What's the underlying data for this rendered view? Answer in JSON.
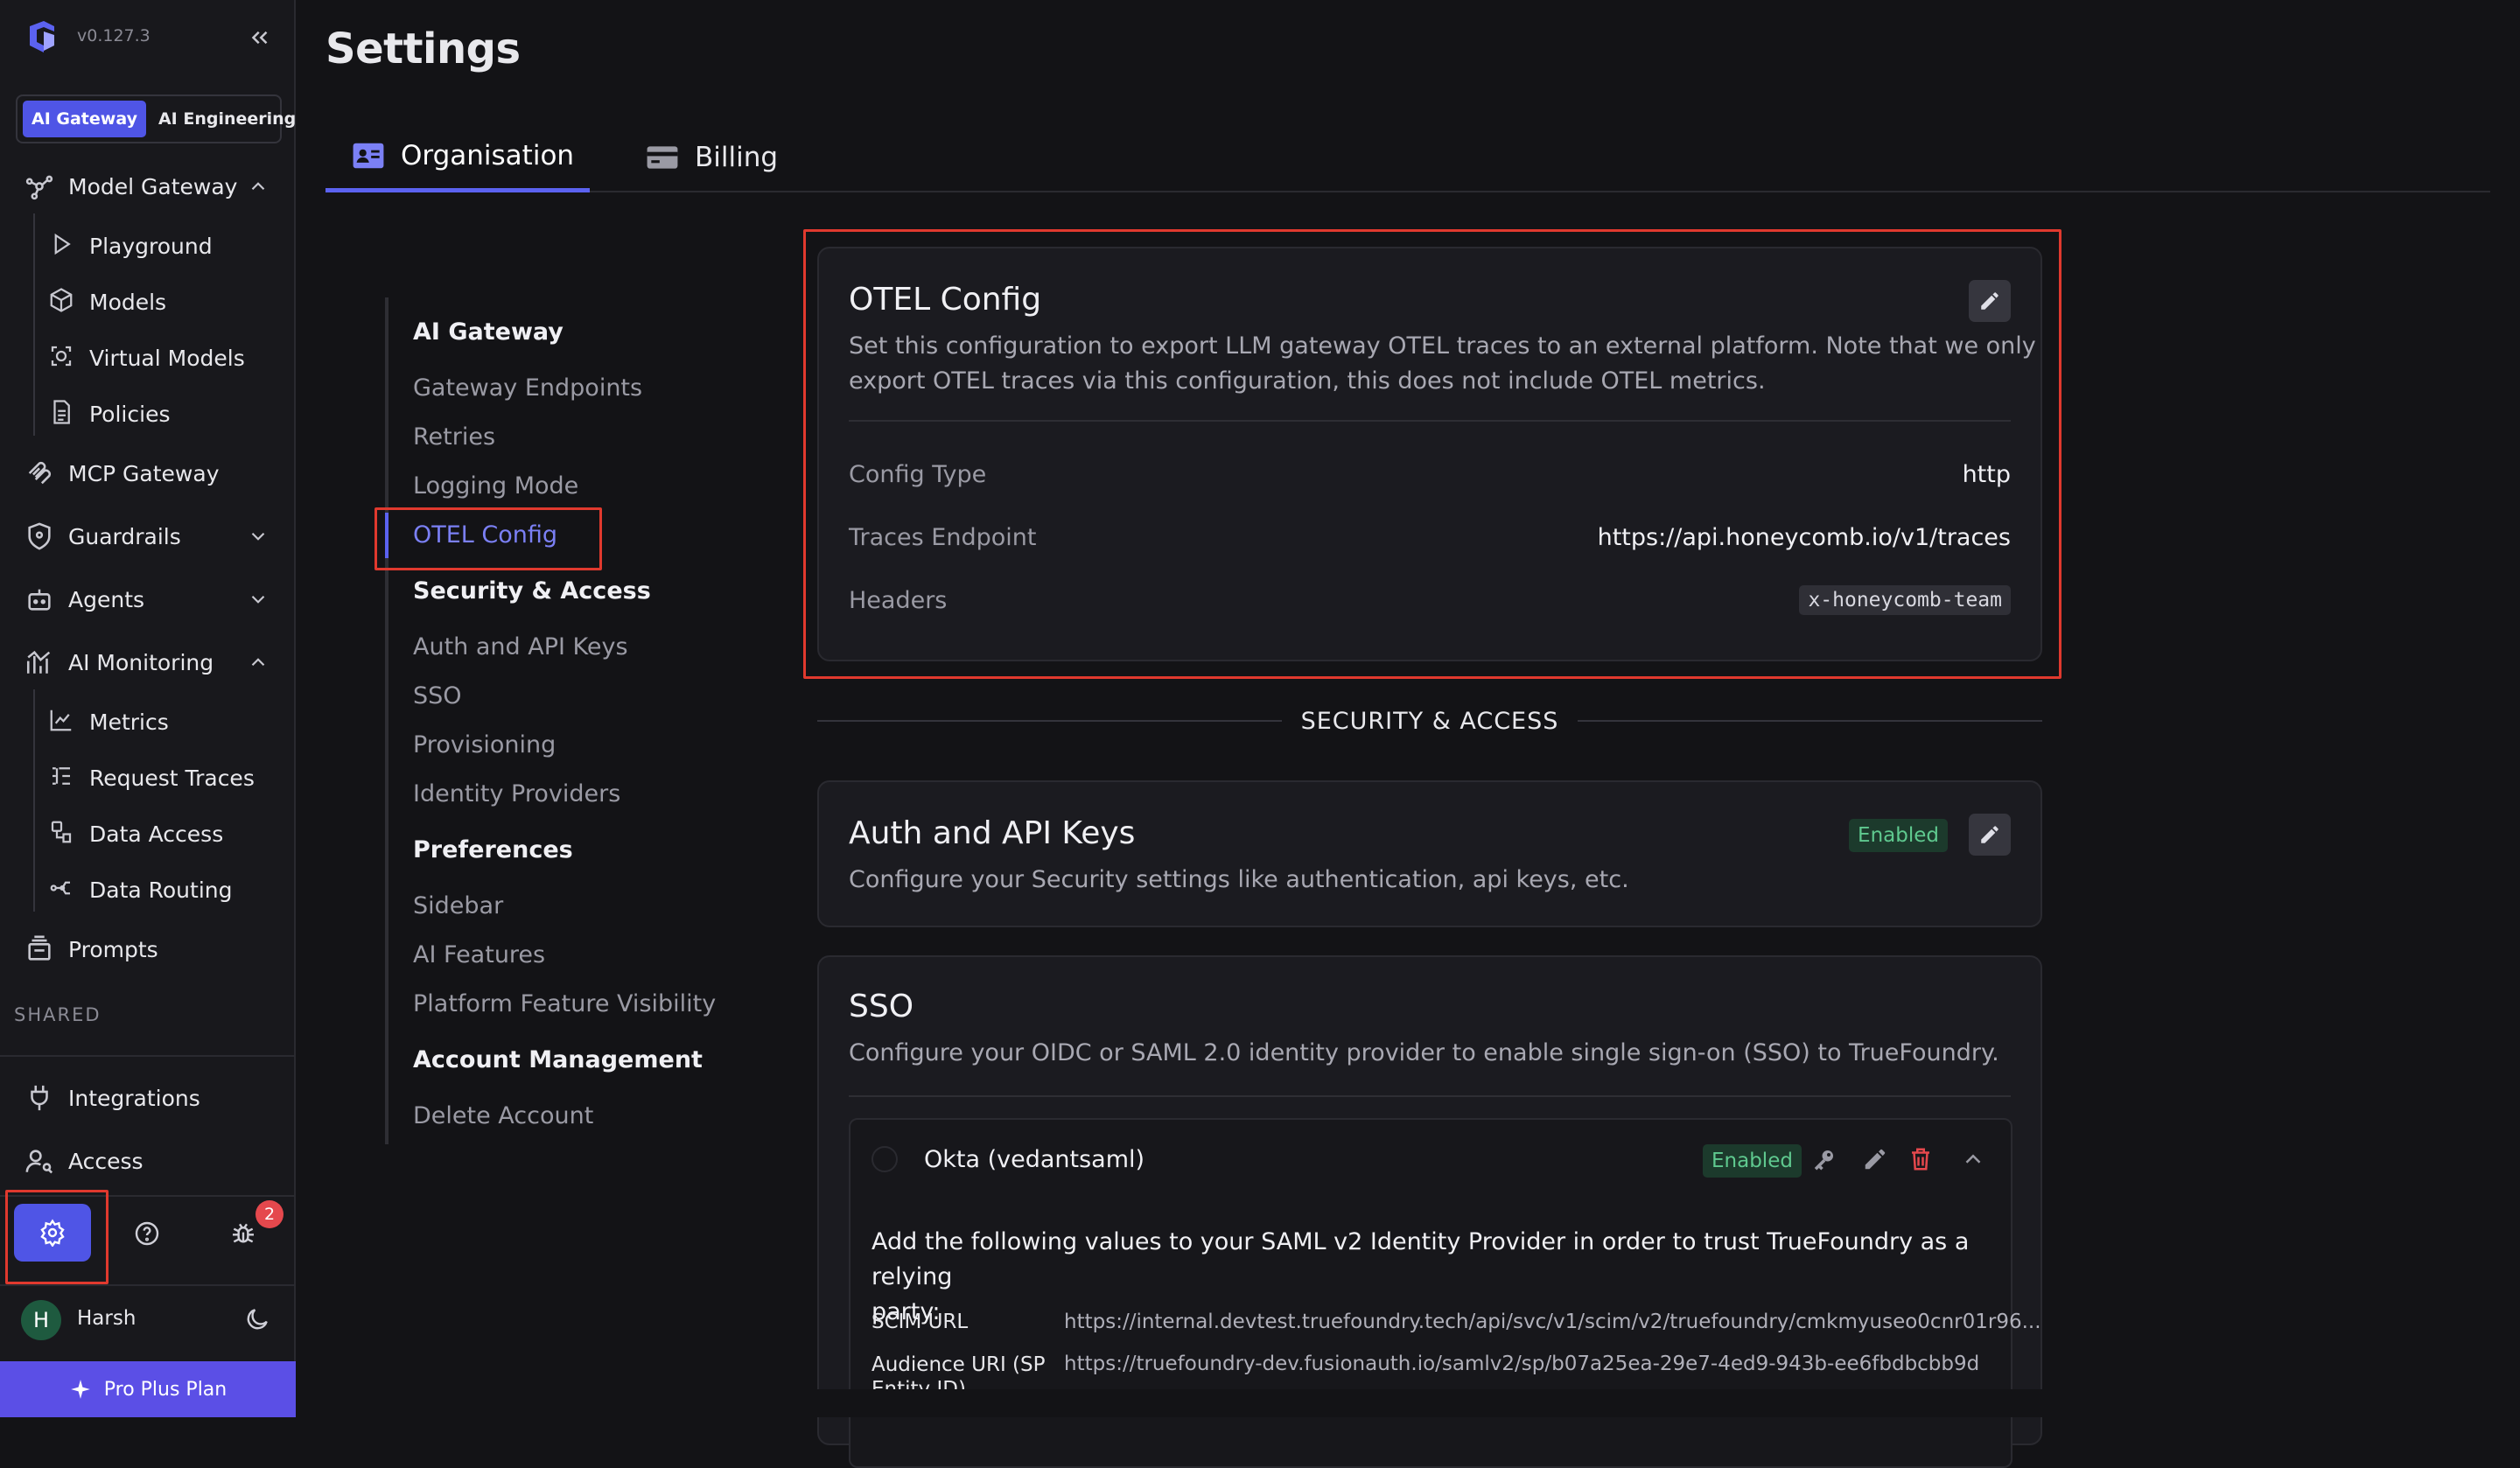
{
  "app": {
    "version": "v0.127.3"
  },
  "mode_switch": {
    "items": [
      "AI Gateway",
      "AI Engineering"
    ],
    "active": "AI Gateway"
  },
  "sidebar": {
    "model_gateway": "Model Gateway",
    "model_gateway_items": [
      "Playground",
      "Models",
      "Virtual Models",
      "Policies"
    ],
    "mcp_gateway": "MCP Gateway",
    "guardrails": "Guardrails",
    "agents": "Agents",
    "ai_monitoring": "AI Monitoring",
    "ai_monitoring_items": [
      "Metrics",
      "Request Traces",
      "Data Access",
      "Data Routing"
    ],
    "prompts": "Prompts",
    "shared_label": "SHARED",
    "integrations": "Integrations",
    "access": "Access",
    "notifications_count": "2",
    "user_initial": "H",
    "user_name": "Harsh",
    "plan": "Pro Plus Plan"
  },
  "page": {
    "title": "Settings"
  },
  "tabs": [
    "Organisation",
    "Billing"
  ],
  "toc": {
    "ai_gateway": "AI Gateway",
    "ai_gateway_items": [
      "Gateway Endpoints",
      "Retries",
      "Logging Mode",
      "OTEL Config"
    ],
    "security": "Security & Access",
    "security_items": [
      "Auth and API Keys",
      "SSO",
      "Provisioning",
      "Identity Providers"
    ],
    "preferences": "Preferences",
    "preferences_items": [
      "Sidebar",
      "AI Features",
      "Platform Feature Visibility"
    ],
    "account": "Account Management",
    "account_items": [
      "Delete Account"
    ],
    "active": "OTEL Config"
  },
  "otel": {
    "title": "OTEL Config",
    "desc_line1": "Set this configuration to export LLM gateway OTEL traces to an external platform. Note that we only",
    "desc_line2": "export OTEL traces via this configuration, this does not include OTEL metrics.",
    "config_type_label": "Config Type",
    "config_type": "http",
    "endpoint_label": "Traces Endpoint",
    "endpoint": "https://api.honeycomb.io/v1/traces",
    "headers_label": "Headers",
    "headers": "x-honeycomb-team"
  },
  "section_divider": "SECURITY & ACCESS",
  "auth": {
    "title": "Auth and API Keys",
    "status": "Enabled",
    "desc": "Configure your Security settings like authentication, api keys, etc."
  },
  "sso": {
    "title": "SSO",
    "desc": "Configure your OIDC or SAML 2.0 identity provider to enable single sign-on (SSO) to TrueFoundry.",
    "provider": {
      "name": "Okta (vedantsaml)",
      "status": "Enabled",
      "intro_line1": "Add the following values to your SAML v2 Identity Provider in order to trust TrueFoundry as a relying",
      "intro_line2": "party:",
      "scim_label": "SCIM URL",
      "scim_value": "https://internal.devtest.truefoundry.tech/api/svc/v1/scim/v2/truefoundry/cmkmyuseo0cnr01r96...",
      "audience_label": "Audience URI (SP Entity ID)",
      "audience_value": "https://truefoundry-dev.fusionauth.io/samlv2/sp/b07a25ea-29e7-4ed9-943b-ee6fbdbcbb9d"
    }
  },
  "colors": {
    "accent": "#5b62f0",
    "highlight": "#e0392e",
    "enabled_text": "#5fc98f",
    "background": "#131316"
  }
}
